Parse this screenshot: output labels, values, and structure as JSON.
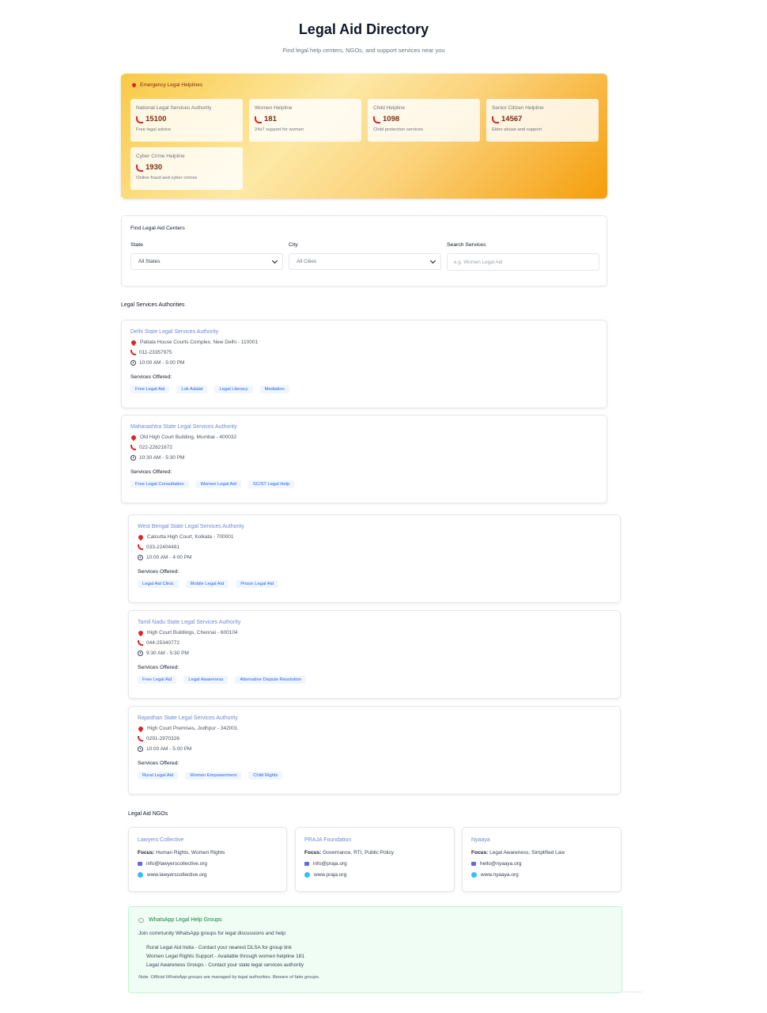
{
  "header": {
    "title": "Legal Aid Directory",
    "subtitle": "Find legal help centers, NGOs, and support services near you"
  },
  "emergency": {
    "heading": "Emergency Legal Helplines",
    "helplines": [
      {
        "name": "National Legal Services Authority",
        "number": "15100",
        "desc": "Free legal advice"
      },
      {
        "name": "Women Helpline",
        "number": "181",
        "desc": "24x7 support for women"
      },
      {
        "name": "Child Helpline",
        "number": "1098",
        "desc": "Child protection services"
      },
      {
        "name": "Senior Citizen Helpline",
        "number": "14567",
        "desc": "Elder abuse and support"
      },
      {
        "name": "Cyber Crime Helpline",
        "number": "1930",
        "desc": "Online fraud and cyber crimes"
      }
    ]
  },
  "search": {
    "title": "Find Legal Aid Centers",
    "state_label": "State",
    "state_value": "All States",
    "city_label": "City",
    "city_value": "All Cities",
    "query_label": "Search Services",
    "query_placeholder": "e.g. Women Legal Aid"
  },
  "authorities": {
    "title": "Legal Services Authorities",
    "services_label": "Services Offered:",
    "items": [
      {
        "name": "Delhi State Legal Services Authority",
        "address": "Patiala House Courts Complex, New Delhi - 110001",
        "phone": "011-23357975",
        "hours": "10:00 AM - 5:00 PM",
        "services": [
          "Free Legal Aid",
          "Lok Adalat",
          "Legal Literacy",
          "Mediation"
        ]
      },
      {
        "name": "Maharashtra State Legal Services Authority",
        "address": "Old High Court Building, Mumbai - 400032",
        "phone": "022-22621672",
        "hours": "10:30 AM - 5:30 PM",
        "services": [
          "Free Legal Consultation",
          "Women Legal Aid",
          "SC/ST Legal Help"
        ]
      },
      {
        "name": "West Bengal State Legal Services Authority",
        "address": "Calcutta High Court, Kolkata - 700001",
        "phone": "033-22404481",
        "hours": "10:00 AM - 4:00 PM",
        "services": [
          "Legal Aid Clinic",
          "Mobile Legal Aid",
          "Prison Legal Aid"
        ]
      },
      {
        "name": "Tamil Nadu State Legal Services Authority",
        "address": "High Court Buildings, Chennai - 600104",
        "phone": "044-25340772",
        "hours": "9:30 AM - 5:30 PM",
        "services": [
          "Free Legal Aid",
          "Legal Awareness",
          "Alternative Dispute Resolution"
        ]
      },
      {
        "name": "Rajasthan State Legal Services Authority",
        "address": "High Court Premises, Jodhpur - 342001",
        "phone": "0291-2970326",
        "hours": "10:00 AM - 5:00 PM",
        "services": [
          "Rural Legal Aid",
          "Women Empowerment",
          "Child Rights"
        ]
      }
    ]
  },
  "ngos": {
    "title": "Legal Aid NGOs",
    "focus_label": "Focus:",
    "items": [
      {
        "name": "Lawyers Collective",
        "focus": "Human Rights, Women Rights",
        "email": "info@lawyerscollective.org",
        "website": "www.lawyerscollective.org"
      },
      {
        "name": "PRAJA Foundation",
        "focus": "Governance, RTI, Public Policy",
        "email": "info@praja.org",
        "website": "www.praja.org"
      },
      {
        "name": "Nyaaya",
        "focus": "Legal Awareness, Simplified Law",
        "email": "hello@nyaaya.org",
        "website": "www.nyaaya.org"
      }
    ]
  },
  "whatsapp": {
    "title": "WhatsApp Legal Help Groups",
    "intro": "Join community WhatsApp groups for legal discussions and help:",
    "items": [
      "Rural Legal Aid India - Contact your nearest DLSA for group link",
      "Women Legal Rights Support - Available through women helpline 181",
      "Legal Awareness Groups - Contact your state legal services authority"
    ],
    "note": "Note: Official WhatsApp groups are managed by legal authorities. Beware of fake groups."
  }
}
